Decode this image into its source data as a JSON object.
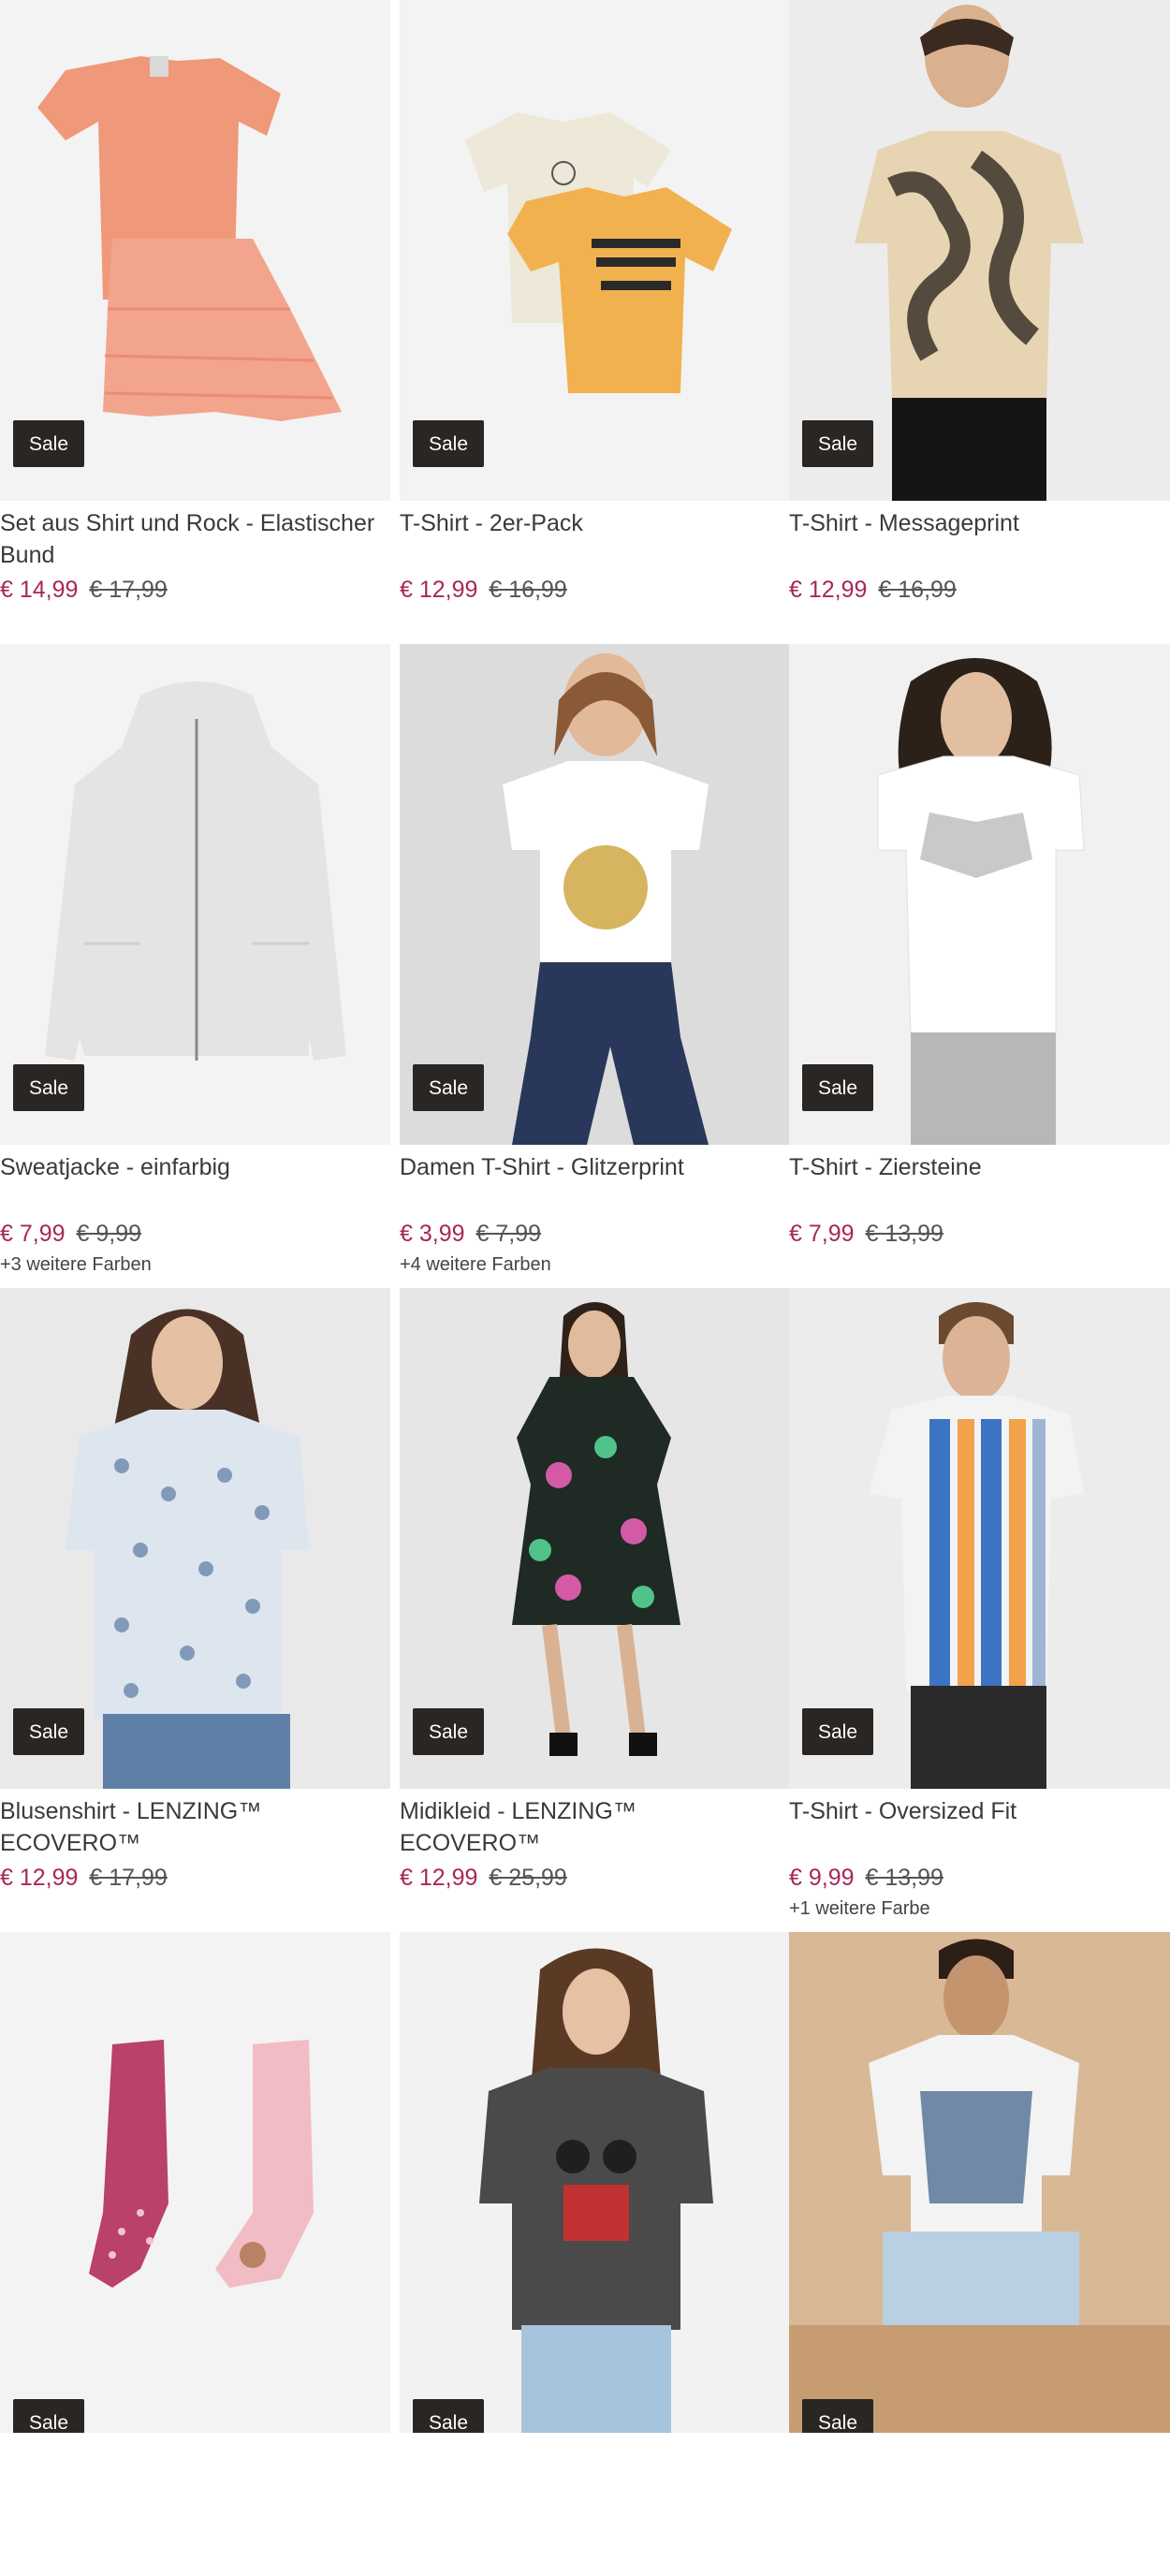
{
  "sale_label": "Sale",
  "colors": {
    "price": "#a8275a",
    "badge_bg": "#2a2624",
    "image_bg": "#efefef"
  },
  "products": [
    {
      "title": "Set aus Shirt und Rock - Elastischer Bund",
      "price": "€ 14,99",
      "old_price": "€ 17,99",
      "more_colors": "",
      "image": "peach-shirt-and-tulle-skirt"
    },
    {
      "title": "T-Shirt - 2er-Pack",
      "price": "€ 12,99",
      "old_price": "€ 16,99",
      "more_colors": "",
      "image": "two-tshirts-cream-and-yellow"
    },
    {
      "title": "T-Shirt - Messageprint",
      "price": "€ 12,99",
      "old_price": "€ 16,99",
      "more_colors": "",
      "image": "man-tie-dye-tshirt"
    },
    {
      "title": "Sweatjacke - einfarbig",
      "price": "€ 7,99",
      "old_price": "€ 9,99",
      "more_colors": "+3 weitere Farben",
      "image": "grey-zip-hoodie"
    },
    {
      "title": "Damen T-Shirt - Glitzerprint",
      "price": "€ 3,99",
      "old_price": "€ 7,99",
      "more_colors": "+4 weitere Farben",
      "image": "woman-white-tshirt-gold-print"
    },
    {
      "title": "T-Shirt - Ziersteine",
      "price": "€ 7,99",
      "old_price": "€ 13,99",
      "more_colors": "",
      "image": "woman-white-tshirt-butterfly"
    },
    {
      "title": "Blusenshirt - LENZING™ ECOVERO™",
      "price": "€ 12,99",
      "old_price": "€ 17,99",
      "more_colors": "",
      "image": "woman-printed-blouse"
    },
    {
      "title": "Midikleid - LENZING™ ECOVERO™",
      "price": "€ 12,99",
      "old_price": "€ 25,99",
      "more_colors": "",
      "image": "woman-floral-midi-dress"
    },
    {
      "title": "T-Shirt - Oversized Fit",
      "price": "€ 9,99",
      "old_price": "€ 13,99",
      "more_colors": "+1 weitere Farbe",
      "image": "man-striped-tshirt"
    },
    {
      "title": "",
      "price": "",
      "old_price": "",
      "more_colors": "",
      "image": "kids-tights-pink-pair"
    },
    {
      "title": "",
      "price": "",
      "old_price": "",
      "more_colors": "",
      "image": "woman-grey-mickey-tshirt"
    },
    {
      "title": "",
      "price": "",
      "old_price": "",
      "more_colors": "",
      "image": "man-white-palm-tshirt"
    }
  ]
}
